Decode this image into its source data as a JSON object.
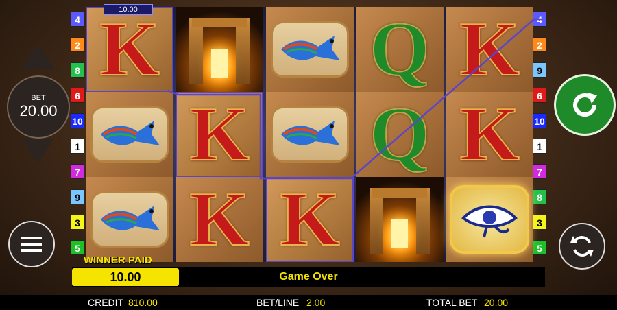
{
  "paylines_left": [
    {
      "num": "4",
      "bg": "#5a5aff",
      "fg": "#ffffff"
    },
    {
      "num": "2",
      "bg": "#ff8a1a",
      "fg": "#ffffff"
    },
    {
      "num": "8",
      "bg": "#22c24a",
      "fg": "#ffffff"
    },
    {
      "num": "6",
      "bg": "#e01a1a",
      "fg": "#ffffff"
    },
    {
      "num": "10",
      "bg": "#1a2aff",
      "fg": "#ffffff"
    },
    {
      "num": "1",
      "bg": "#ffffff",
      "fg": "#000000"
    },
    {
      "num": "7",
      "bg": "#d12adf",
      "fg": "#ffffff"
    },
    {
      "num": "9",
      "bg": "#7ac6ff",
      "fg": "#000000"
    },
    {
      "num": "3",
      "bg": "#f5f51a",
      "fg": "#000000"
    },
    {
      "num": "5",
      "bg": "#1fbf2a",
      "fg": "#ffffff"
    }
  ],
  "paylines_right": [
    {
      "num": "4",
      "bg": "#5a5aff",
      "fg": "#ffffff"
    },
    {
      "num": "2",
      "bg": "#ff8a1a",
      "fg": "#ffffff"
    },
    {
      "num": "9",
      "bg": "#7ac6ff",
      "fg": "#000000"
    },
    {
      "num": "6",
      "bg": "#e01a1a",
      "fg": "#ffffff"
    },
    {
      "num": "10",
      "bg": "#1a2aff",
      "fg": "#ffffff"
    },
    {
      "num": "1",
      "bg": "#ffffff",
      "fg": "#000000"
    },
    {
      "num": "7",
      "bg": "#d12adf",
      "fg": "#ffffff"
    },
    {
      "num": "8",
      "bg": "#22c24a",
      "fg": "#ffffff"
    },
    {
      "num": "3",
      "bg": "#f5f51a",
      "fg": "#000000"
    },
    {
      "num": "5",
      "bg": "#1fbf2a",
      "fg": "#ffffff"
    }
  ],
  "reels": [
    {
      "symbols": [
        "K",
        "bird",
        "bird"
      ]
    },
    {
      "symbols": [
        "temple",
        "K",
        "K"
      ]
    },
    {
      "symbols": [
        "bird",
        "bird",
        "K"
      ]
    },
    {
      "symbols": [
        "Q",
        "Q",
        "temple"
      ]
    },
    {
      "symbols": [
        "K",
        "K",
        "eye"
      ]
    }
  ],
  "winning_line_tag": "10.00",
  "bet": {
    "label": "BET",
    "value": "20.00"
  },
  "status": {
    "winner_label": "WINNER PAID",
    "winner_amount": "10.00",
    "message": "Game Over"
  },
  "footer": {
    "credit_label": "CREDIT",
    "credit_value": "810.00",
    "betline_label": "BET/LINE",
    "betline_value": "2.00",
    "totalbet_label": "TOTAL BET",
    "totalbet_value": "20.00"
  },
  "colors": {
    "payline": "#5b45c9",
    "spin": "#1f8a2a",
    "winner": "#f5e400"
  },
  "icons": {
    "spin": "spin-arrow-icon",
    "autoplay": "autoplay-icon",
    "menu": "menu-icon"
  }
}
